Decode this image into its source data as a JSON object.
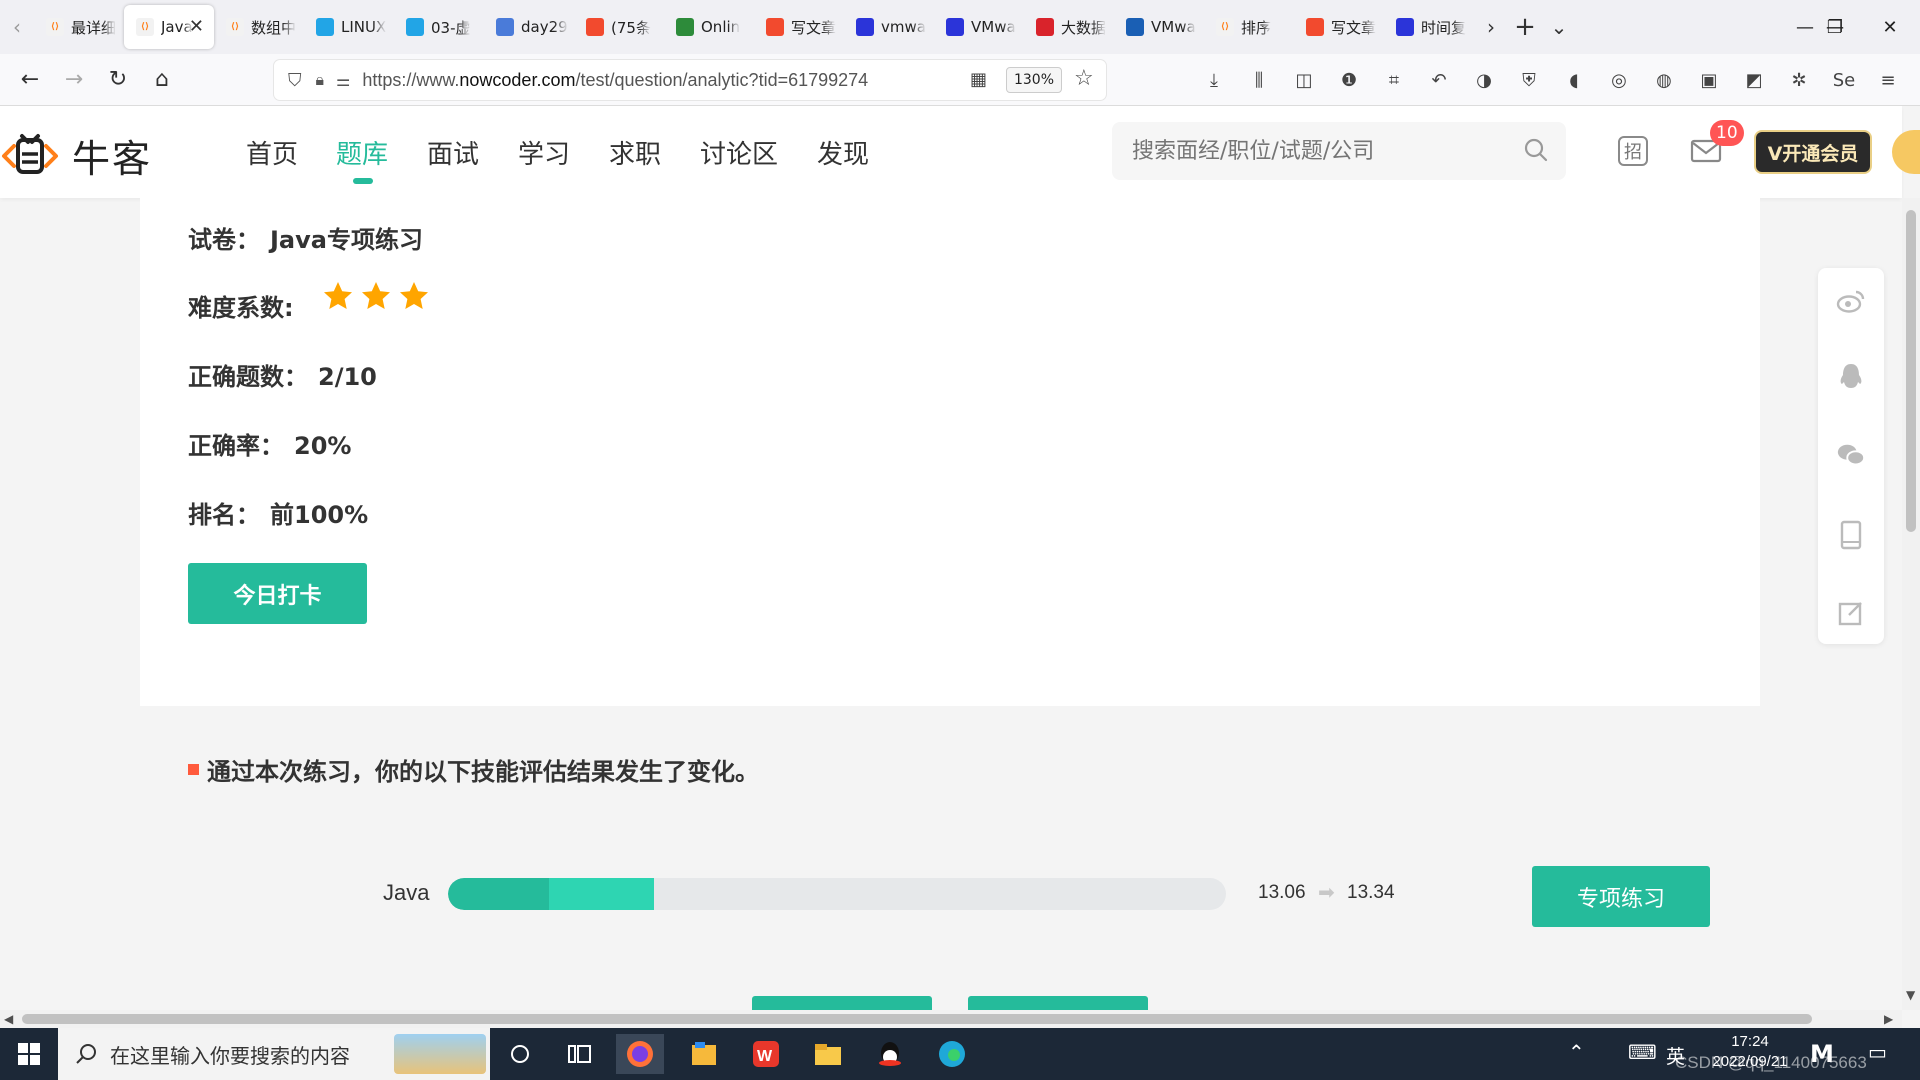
{
  "browser": {
    "tabs": [
      {
        "label": "最详细",
        "icon": "nowcoder-icon",
        "color": "#f2f2f2"
      },
      {
        "label": "Java",
        "icon": "nowcoder-icon",
        "color": "#f2f2f2",
        "active": true
      },
      {
        "label": "数组中",
        "icon": "nowcoder-icon",
        "color": "#f2f2f2"
      },
      {
        "label": "LINUX",
        "icon": "bilibili-icon",
        "color": "#22a5e6"
      },
      {
        "label": "03-虚",
        "icon": "bilibili-icon",
        "color": "#22a5e6"
      },
      {
        "label": "day29",
        "icon": "cloud-icon",
        "color": "#4a7bd9"
      },
      {
        "label": "(75条",
        "icon": "csdn-icon",
        "color": "#f24a2e"
      },
      {
        "label": "Onlin",
        "icon": "code-icon",
        "color": "#2d8b3a"
      },
      {
        "label": "写文章",
        "icon": "csdn-icon",
        "color": "#f24a2e"
      },
      {
        "label": "vmwa",
        "icon": "baidu-icon",
        "color": "#2b34d9"
      },
      {
        "label": "VMwa",
        "icon": "baidu-icon",
        "color": "#2b34d9"
      },
      {
        "label": "大数据",
        "icon": "huawei-icon",
        "color": "#d9232b"
      },
      {
        "label": "VMwa",
        "icon": "vmware-icon",
        "color": "#1a5fb4"
      },
      {
        "label": "排序",
        "icon": "nowcoder-icon",
        "color": "#f2f2f2"
      },
      {
        "label": "写文章",
        "icon": "csdn-icon",
        "color": "#f24a2e"
      },
      {
        "label": "时间复",
        "icon": "baidu-icon",
        "color": "#2b34d9"
      }
    ],
    "url_prefix": "https://www.",
    "url_domain": "nowcoder.com",
    "url_path": "/test/question/analytic?tid=61799274",
    "zoom": "130%"
  },
  "site": {
    "logo_text": "牛客",
    "nav": [
      "首页",
      "题库",
      "面试",
      "学习",
      "求职",
      "讨论区",
      "发现"
    ],
    "active_nav": "题库",
    "search_placeholder": "搜索面经/职位/试题/公司",
    "zhao_label": "招",
    "mail_badge": "10",
    "vip_label": "V开通会员"
  },
  "result": {
    "paper_label": "试卷：",
    "paper_value": "Java专项练习",
    "difficulty_label": "难度系数:",
    "difficulty_stars": 3,
    "correct_label": "正确题数：",
    "correct_value": "2/10",
    "rate_label": "正确率：",
    "rate_value": "20%",
    "rank_label": "排名：",
    "rank_value": "前100%",
    "checkin_button": "今日打卡"
  },
  "skills": {
    "section_title": "通过本次练习，你的以下技能评估结果发生了变化。",
    "items": [
      {
        "name": "Java",
        "from": "13.06",
        "to": "13.34",
        "old_fill": 0.13,
        "new_fill": 0.265
      }
    ],
    "practice_button": "专项练习"
  },
  "taskbar": {
    "search_text": "在这里输入你要搜索的内容",
    "ime": "英",
    "time": "17:24",
    "date": "2022/09/21",
    "watermark": "CSDN @qq_1140075663"
  }
}
